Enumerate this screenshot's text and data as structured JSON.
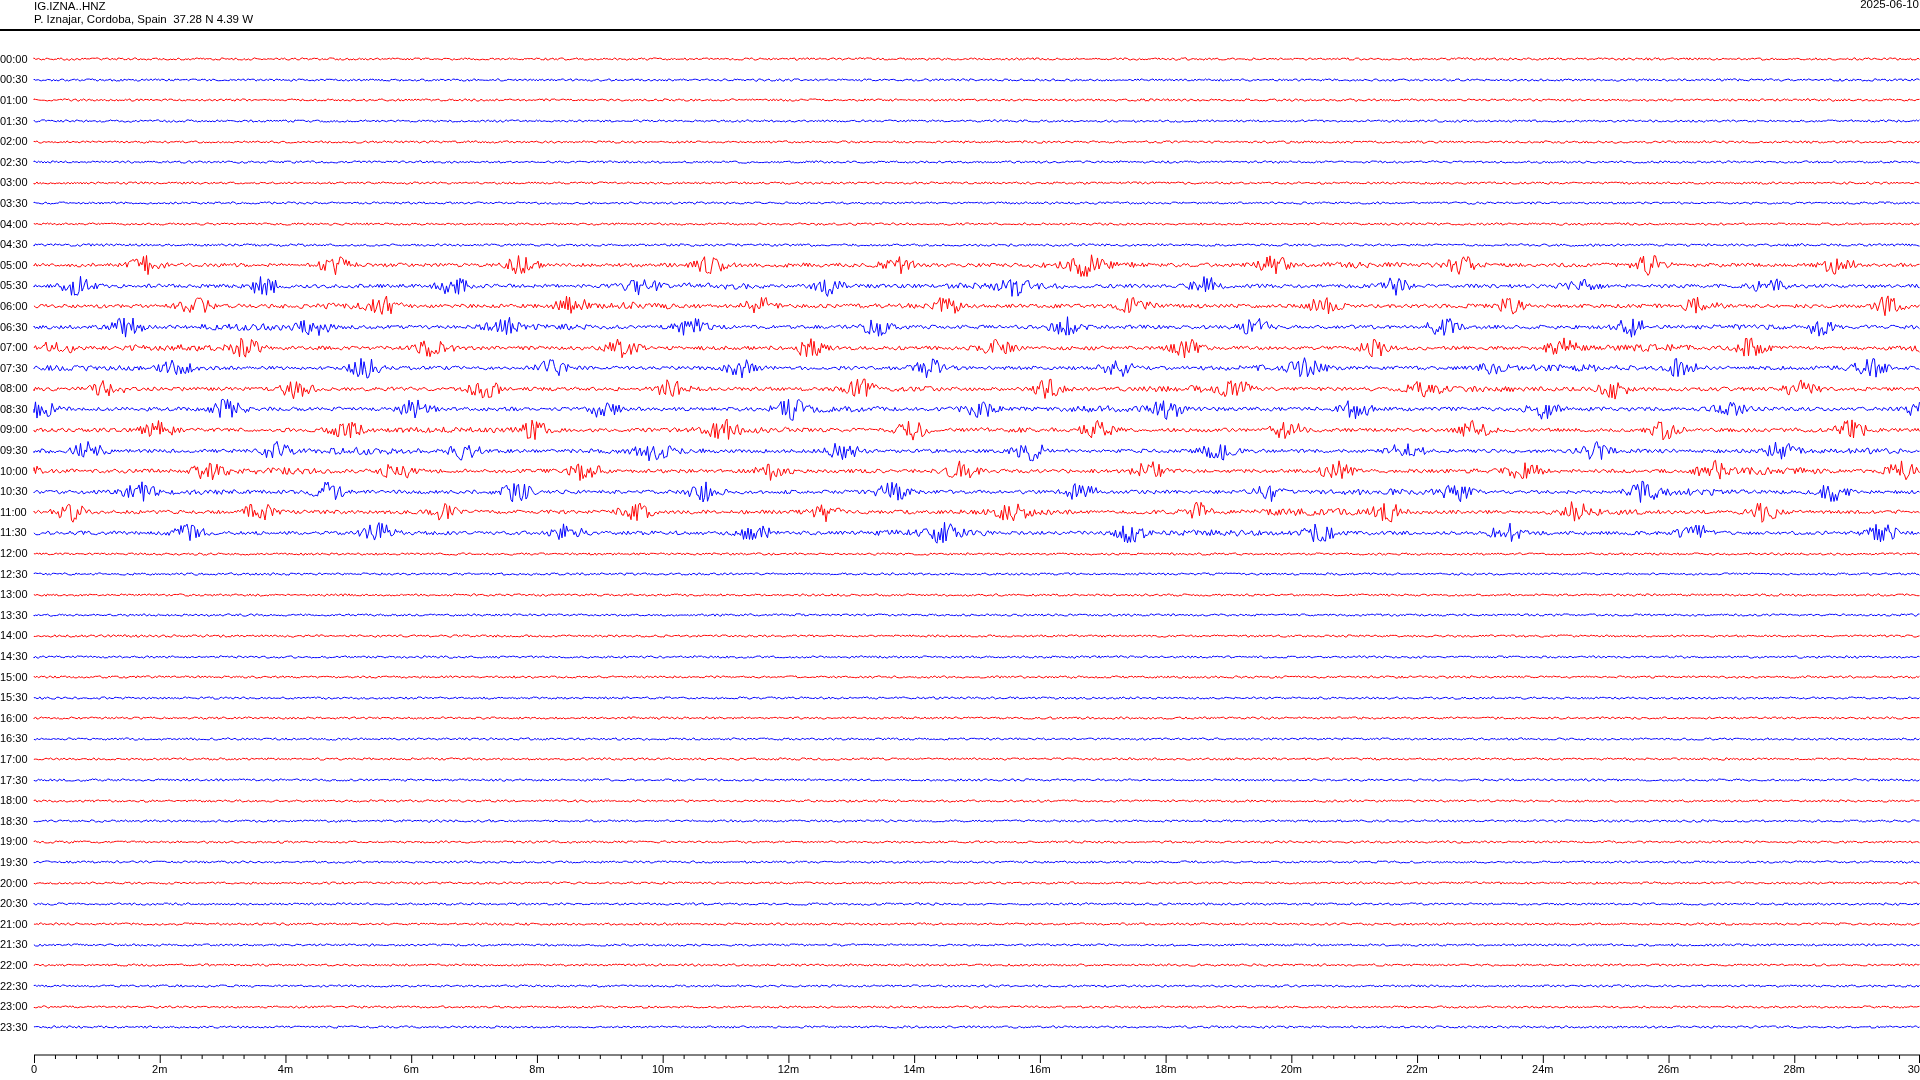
{
  "header": {
    "station": "IG.IZNA..HNZ",
    "location": "P. Iznajar, Cordoba, Spain  37.28 N 4.39 W",
    "date": "2025-06-10"
  },
  "rows": [
    {
      "time": "00:00",
      "color": "#ff0000"
    },
    {
      "time": "00:30",
      "color": "#0000ff"
    },
    {
      "time": "01:00",
      "color": "#ff0000"
    },
    {
      "time": "01:30",
      "color": "#0000ff"
    },
    {
      "time": "02:00",
      "color": "#ff0000"
    },
    {
      "time": "02:30",
      "color": "#0000ff"
    },
    {
      "time": "03:00",
      "color": "#ff0000"
    },
    {
      "time": "03:30",
      "color": "#0000ff"
    },
    {
      "time": "04:00",
      "color": "#ff0000"
    },
    {
      "time": "04:30",
      "color": "#0000ff"
    },
    {
      "time": "05:00",
      "color": "#ff0000"
    },
    {
      "time": "05:30",
      "color": "#0000ff"
    },
    {
      "time": "06:00",
      "color": "#ff0000"
    },
    {
      "time": "06:30",
      "color": "#0000ff"
    },
    {
      "time": "07:00",
      "color": "#ff0000"
    },
    {
      "time": "07:30",
      "color": "#0000ff"
    },
    {
      "time": "08:00",
      "color": "#ff0000"
    },
    {
      "time": "08:30",
      "color": "#0000ff"
    },
    {
      "time": "09:00",
      "color": "#ff0000"
    },
    {
      "time": "09:30",
      "color": "#0000ff"
    },
    {
      "time": "10:00",
      "color": "#ff0000"
    },
    {
      "time": "10:30",
      "color": "#0000ff"
    },
    {
      "time": "11:00",
      "color": "#ff0000"
    },
    {
      "time": "11:30",
      "color": "#0000ff"
    },
    {
      "time": "12:00",
      "color": "#ff0000"
    },
    {
      "time": "12:30",
      "color": "#0000ff"
    },
    {
      "time": "13:00",
      "color": "#ff0000"
    },
    {
      "time": "13:30",
      "color": "#0000ff"
    },
    {
      "time": "14:00",
      "color": "#ff0000"
    },
    {
      "time": "14:30",
      "color": "#0000ff"
    },
    {
      "time": "15:00",
      "color": "#ff0000"
    },
    {
      "time": "15:30",
      "color": "#0000ff"
    },
    {
      "time": "16:00",
      "color": "#ff0000"
    },
    {
      "time": "16:30",
      "color": "#0000ff"
    },
    {
      "time": "17:00",
      "color": "#ff0000"
    },
    {
      "time": "17:30",
      "color": "#0000ff"
    },
    {
      "time": "18:00",
      "color": "#ff0000"
    },
    {
      "time": "18:30",
      "color": "#0000ff"
    },
    {
      "time": "19:00",
      "color": "#ff0000"
    },
    {
      "time": "19:30",
      "color": "#0000ff"
    },
    {
      "time": "20:00",
      "color": "#ff0000"
    },
    {
      "time": "20:30",
      "color": "#0000ff"
    },
    {
      "time": "21:00",
      "color": "#ff0000"
    },
    {
      "time": "21:30",
      "color": "#0000ff"
    },
    {
      "time": "22:00",
      "color": "#ff0000"
    },
    {
      "time": "22:30",
      "color": "#0000ff"
    },
    {
      "time": "23:00",
      "color": "#ff0000"
    },
    {
      "time": "23:30",
      "color": "#0000ff"
    }
  ],
  "axis": {
    "labels": [
      "0",
      "2m",
      "4m",
      "6m",
      "8m",
      "10m",
      "12m",
      "14m",
      "16m",
      "18m",
      "20m",
      "22m",
      "24m",
      "26m",
      "28m",
      "30"
    ]
  }
}
